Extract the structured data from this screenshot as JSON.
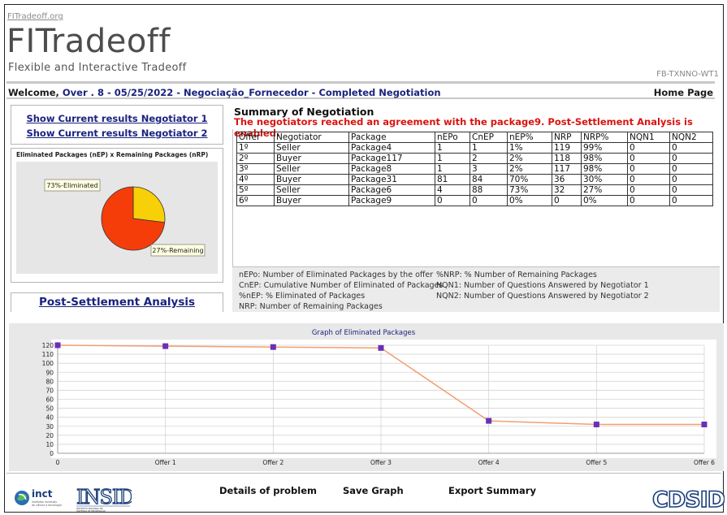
{
  "header": {
    "site_link": "FITradeoff.org",
    "logo_title": "FITradeoff",
    "logo_subtitle": "Flexible and Interactive Tradeoff",
    "page_code": "FB-TXNNO-WT1"
  },
  "welcome": {
    "prefix": "Welcome, ",
    "blue_text": "Over . 8 - 05/25/2022 - Negociação_Fornecedor - Completed Negotiation",
    "home_link": "Home Page"
  },
  "sidebar": {
    "negotiator_1_link": "Show Current results Negotiator 1",
    "negotiator_2_link": "Show Current results Negotiator 2",
    "pie_title": "Eliminated Packages (nEP) x Remaining Packages (nRP)",
    "pie_labels": {
      "eliminated": "73%-Eliminated",
      "remaining": "27%-Remaining"
    },
    "pie_values": {
      "eliminated": 73,
      "remaining": 27
    },
    "pie_colors": {
      "eliminated": "#f53d0a",
      "remaining": "#f7d007"
    },
    "post_settlement_link": "Post-Settlement Analysis"
  },
  "summary": {
    "title": "Summary of Negotiation",
    "agreement_message": "The negotiators reached an agreement with the package9. Post-Settlement Analysis is enabled.",
    "columns": [
      "Offer",
      "Negotiator",
      "Package",
      "nEPo",
      "CnEP",
      "nEP%",
      "NRP",
      "NRP%",
      "NQN1",
      "NQN2"
    ],
    "rows": [
      [
        "1º",
        "Seller",
        "Package4",
        "1",
        "1",
        "1%",
        "119",
        "99%",
        "0",
        "0"
      ],
      [
        "2º",
        "Buyer",
        "Package117",
        "1",
        "2",
        "2%",
        "118",
        "98%",
        "0",
        "0"
      ],
      [
        "3º",
        "Seller",
        "Package8",
        "1",
        "3",
        "2%",
        "117",
        "98%",
        "0",
        "0"
      ],
      [
        "4º",
        "Buyer",
        "Package31",
        "81",
        "84",
        "70%",
        "36",
        "30%",
        "0",
        "0"
      ],
      [
        "5º",
        "Seller",
        "Package6",
        "4",
        "88",
        "73%",
        "32",
        "27%",
        "0",
        "0"
      ],
      [
        "6º",
        "Buyer",
        "Package9",
        "0",
        "0",
        "0%",
        "0",
        "0%",
        "0",
        "0"
      ]
    ]
  },
  "legend": {
    "left": [
      "nEPo: Number of Eliminated Packages by the offer",
      "CnEP: Cumulative Number of Eliminated of Packages",
      "%nEP: % Eliminated of Packages",
      "NRP: Number of Remaining Packages"
    ],
    "right": [
      "%NRP: % Number of Remaining Packages",
      "NQN1: Number of Questions Answered by Negotiator 1",
      "NQN2: Number of Questions Answered by Negotiator 2"
    ]
  },
  "chart_data": {
    "type": "line",
    "title": "Graph of Eliminated Packages",
    "categories": [
      "0",
      "Offer 1",
      "Offer 2",
      "Offer 3",
      "Offer 4",
      "Offer 5",
      "Offer 6"
    ],
    "values": [
      120,
      119,
      118,
      117,
      36,
      32,
      32
    ],
    "ylim": [
      0,
      120
    ],
    "yticks": [
      0,
      10,
      20,
      30,
      40,
      50,
      60,
      70,
      80,
      90,
      100,
      110,
      120
    ],
    "grid": true,
    "line_color": "#f0a070",
    "marker_color": "#6a2fb8"
  },
  "footer": {
    "details_of_problem": "Details of problem",
    "save_graph": "Save Graph",
    "export_summary": "Export Summary",
    "logos": {
      "inct": "inct",
      "inct_small": "Institutos nacionais de ciência e tecnologia",
      "insid": "INSID",
      "insid_small": "INSTITUTO NACIONAL DE SISTEMAS DE INFORMAÇÃO E DECISÃO",
      "cdsid": "CDSID"
    }
  }
}
